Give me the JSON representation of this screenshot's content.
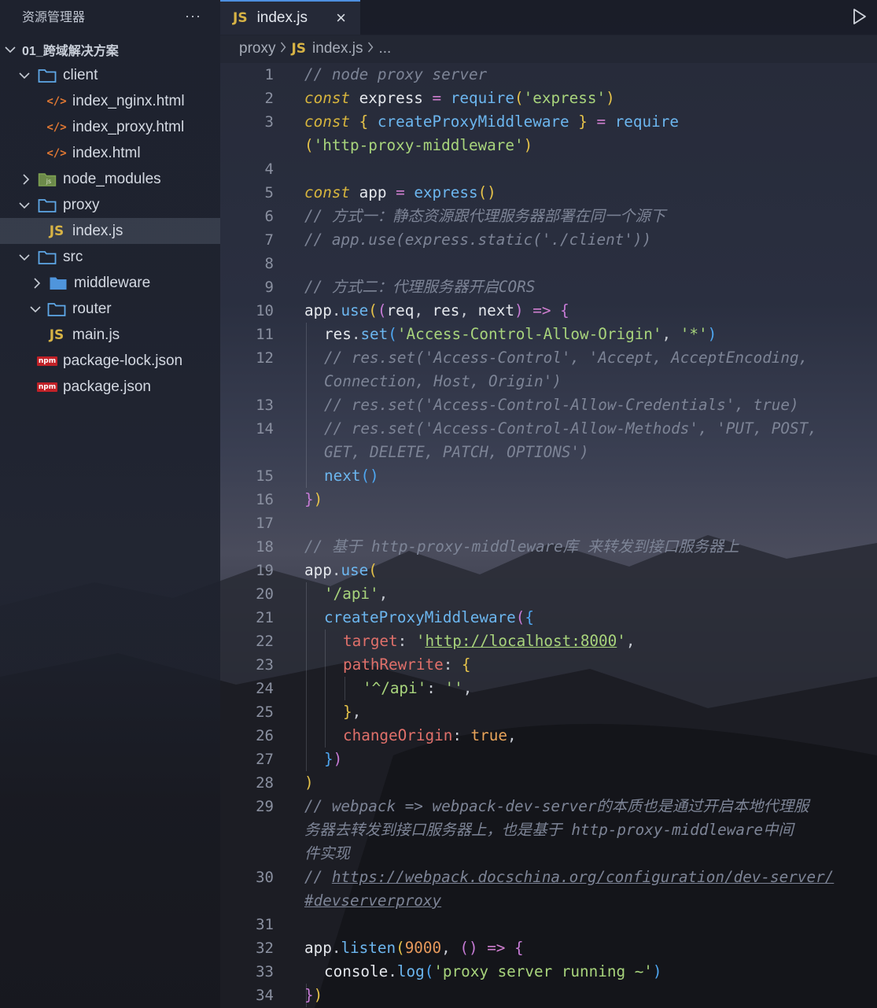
{
  "sidebar": {
    "title": "资源管理器",
    "more_label": "···",
    "items": [
      {
        "label": "01_跨域解决方案",
        "kind": "root"
      },
      {
        "label": "client",
        "kind": "folder-open"
      },
      {
        "label": "index_nginx.html",
        "kind": "html"
      },
      {
        "label": "index_proxy.html",
        "kind": "html"
      },
      {
        "label": "index.html",
        "kind": "html"
      },
      {
        "label": "node_modules",
        "kind": "folder-node"
      },
      {
        "label": "proxy",
        "kind": "folder-open"
      },
      {
        "label": "index.js",
        "kind": "js",
        "selected": true
      },
      {
        "label": "src",
        "kind": "folder-open"
      },
      {
        "label": "middleware",
        "kind": "folder-closed"
      },
      {
        "label": "router",
        "kind": "folder-open"
      },
      {
        "label": "main.js",
        "kind": "js"
      },
      {
        "label": "package-lock.json",
        "kind": "npm"
      },
      {
        "label": "package.json",
        "kind": "npm"
      }
    ]
  },
  "icons": {
    "js": "JS",
    "html": "</>",
    "npm": "npm",
    "close": "×"
  },
  "tab": {
    "label": "index.js"
  },
  "breadcrumb": {
    "folder": "proxy",
    "file": "index.js",
    "more": "..."
  },
  "editor": {
    "line_numbers": [
      "1",
      "2",
      "3",
      "4",
      "5",
      "6",
      "7",
      "8",
      "9",
      "10",
      "11",
      "12",
      "13",
      "14",
      "15",
      "16",
      "17",
      "18",
      "19",
      "20",
      "21",
      "22",
      "23",
      "24",
      "25",
      "26",
      "27",
      "28",
      "29",
      "30",
      "31",
      "32",
      "33",
      "34"
    ]
  },
  "colors": {
    "keyword": "#d7b53d",
    "function": "#6cb6ef",
    "string": "#a8d47c",
    "comment": "#7d8496",
    "property": "#e0706a",
    "accent": "#4d8fe0"
  },
  "code": {
    "l1": "// node proxy server",
    "l2": [
      "const",
      " express ",
      "=",
      " ",
      "require",
      "(",
      "'express'",
      ")"
    ],
    "l3": [
      "const",
      " { ",
      "createProxyMiddleware",
      " } ",
      "=",
      " ",
      "require"
    ],
    "l3b": [
      "(",
      "'http-proxy-middleware'",
      ")"
    ],
    "l5": [
      "const",
      " app ",
      "=",
      " ",
      "express",
      "()"
    ],
    "l6": "// 方式一：静态资源跟代理服务器部署在同一个源下",
    "l7": "// app.use(express.static('./client'))",
    "l9": "// 方式二：代理服务器开启CORS",
    "l10": [
      "app",
      ".",
      "use",
      "(",
      "(",
      "req",
      ", ",
      "res",
      ", ",
      "next",
      ")",
      " ",
      "=>",
      " ",
      "{"
    ],
    "l11": [
      "res",
      ".",
      "set",
      "(",
      "'Access-Control-Allow-Origin'",
      ", ",
      "'*'",
      ")"
    ],
    "l12": "// res.set('Access-Control', 'Accept, AcceptEncoding,",
    "l12b": "Connection, Host, Origin')",
    "l13": "// res.set('Access-Control-Allow-Credentials', true)",
    "l14": "// res.set('Access-Control-Allow-Methods', 'PUT, POST,",
    "l14b": "GET, DELETE, PATCH, OPTIONS')",
    "l15": [
      "next",
      "()"
    ],
    "l16": [
      "}",
      ")"
    ],
    "l18": "// 基于 http-proxy-middleware库 来转发到接口服务器上",
    "l19": [
      "app",
      ".",
      "use",
      "("
    ],
    "l20": [
      "'/api'",
      ","
    ],
    "l21": [
      "createProxyMiddleware",
      "(",
      "{"
    ],
    "l22": [
      "target",
      ": ",
      "'",
      "http://localhost:8000",
      "'",
      ","
    ],
    "l23": [
      "pathRewrite",
      ": ",
      "{"
    ],
    "l24": [
      "'^/api'",
      ": ",
      "''",
      ","
    ],
    "l25": [
      "}",
      ","
    ],
    "l26": [
      "changeOrigin",
      ": ",
      "true",
      ","
    ],
    "l27": [
      "}",
      ")"
    ],
    "l28": [
      ")"
    ],
    "l29": "// webpack => webpack-dev-server的本质也是通过开启本地代理服",
    "l29b": "务器去转发到接口服务器上，也是基于 http-proxy-middleware中间",
    "l29c": "件实现",
    "l30a": "// ",
    "l30": "https://webpack.docschina.org/configuration/dev-server/",
    "l30b": "#devserverproxy",
    "l32": [
      "app",
      ".",
      "listen",
      "(",
      "9000",
      ", ",
      "(",
      ")",
      " ",
      "=>",
      " ",
      "{"
    ],
    "l33": [
      "console",
      ".",
      "log",
      "(",
      "'proxy server running ~'",
      ")"
    ],
    "l34": [
      "}",
      ")"
    ]
  }
}
